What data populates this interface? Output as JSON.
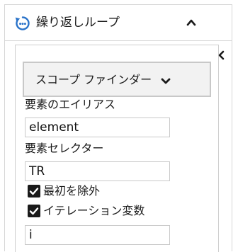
{
  "header": {
    "title": "繰り返しループ",
    "icon": "loop-refresh-icon",
    "accent_color": "#2a73c9",
    "collapse_icon": "chevron-up-icon"
  },
  "panel": {
    "side_collapse_icon": "chevron-left-icon",
    "scope_finder": {
      "label": "スコープ ファインダー",
      "icon": "chevron-down-icon"
    },
    "fields": {
      "element_alias": {
        "label": "要素のエイリアス",
        "value": "element"
      },
      "element_selector": {
        "label": "要素セレクター",
        "value": "TR"
      },
      "iteration_variable": {
        "value": "i"
      }
    },
    "checkboxes": {
      "exclude_first": {
        "label": "最初を除外",
        "checked": true
      },
      "iteration_variable": {
        "label": "イテレーション変数",
        "checked": true
      }
    }
  }
}
